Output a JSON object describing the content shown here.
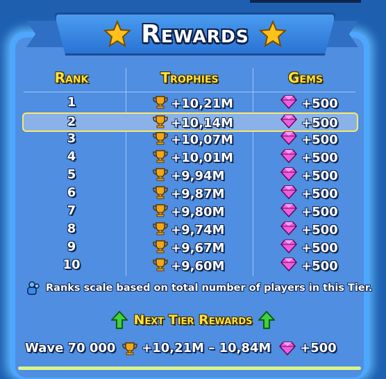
{
  "title": "Rewards",
  "columns": {
    "rank": "Rank",
    "trophies": "Trophies",
    "gems": "Gems"
  },
  "rows": [
    {
      "rank": "1",
      "trophies": "+10,21M",
      "gems": "+500"
    },
    {
      "rank": "2",
      "trophies": "+10,14M",
      "gems": "+500"
    },
    {
      "rank": "3",
      "trophies": "+10,07M",
      "gems": "+500"
    },
    {
      "rank": "4",
      "trophies": "+10,01M",
      "gems": "+500"
    },
    {
      "rank": "5",
      "trophies": "+9,94M",
      "gems": "+500"
    },
    {
      "rank": "6",
      "trophies": "+9,87M",
      "gems": "+500"
    },
    {
      "rank": "7",
      "trophies": "+9,80M",
      "gems": "+500"
    },
    {
      "rank": "8",
      "trophies": "+9,74M",
      "gems": "+500"
    },
    {
      "rank": "9",
      "trophies": "+9,67M",
      "gems": "+500"
    },
    {
      "rank": "10",
      "trophies": "+9,60M",
      "gems": "+500"
    }
  ],
  "highlighted_rank": "2",
  "note": "Ranks scale based on total number of players in this Tier.",
  "next_tier": {
    "label": "Next Tier Rewards",
    "wave": "Wave 70 000",
    "trophies": "+10,21M – 10,84M",
    "gems": "+500"
  },
  "colors": {
    "accent_yellow": "#ffe23a",
    "panel_blue": "#4f8ee0",
    "highlight_border": "#ffe86a",
    "gem_pink": "#f25ce0",
    "trophy_gold": "#f0a818",
    "arrow_green": "#3fd23a"
  },
  "icons": {
    "title": "star-icon",
    "trophy": "trophy-icon",
    "gem": "gem-icon",
    "note": "player-icon",
    "next_tier": "green-up-arrow-icon"
  }
}
